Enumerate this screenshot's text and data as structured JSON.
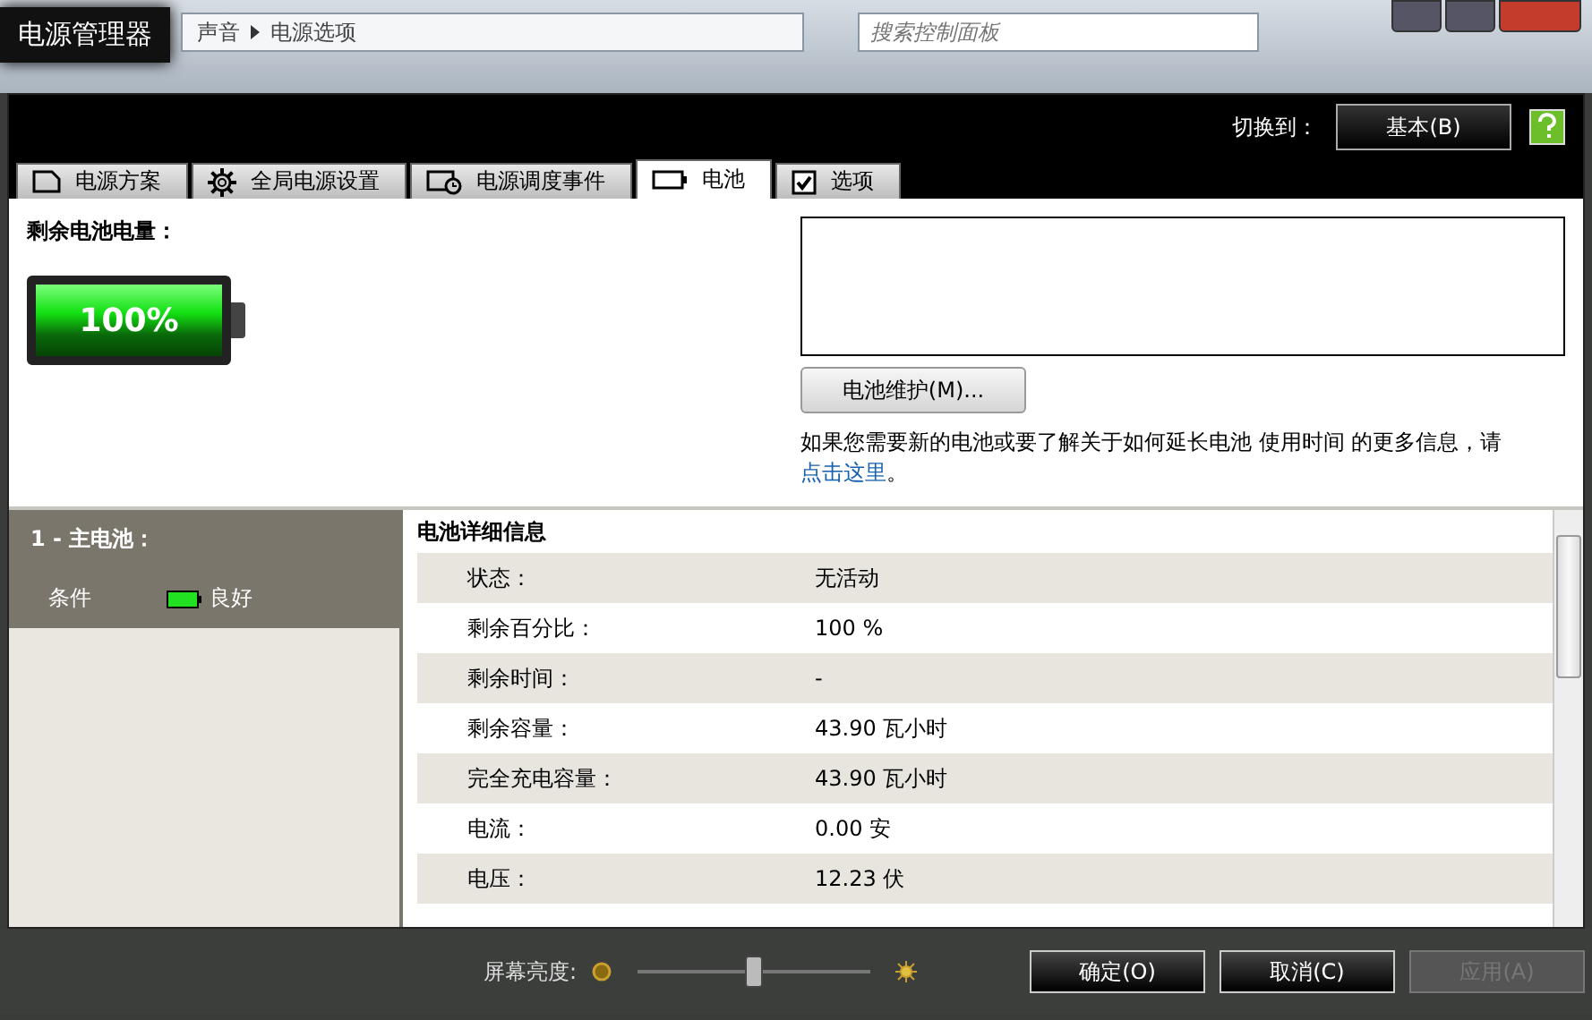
{
  "backdrop": {
    "breadcrumb": [
      "声音",
      "电源选项"
    ],
    "search": {
      "placeholder": "搜索控制面板"
    }
  },
  "window": {
    "title": "电源管理器"
  },
  "header": {
    "switch_label": "切换到：",
    "switch_button": "基本(B)"
  },
  "tabs": [
    {
      "label": "电源方案",
      "kind": "plan",
      "selected": false
    },
    {
      "label": "全局电源设置",
      "kind": "gear",
      "selected": false
    },
    {
      "label": "电源调度事件",
      "kind": "schedule",
      "selected": false
    },
    {
      "label": "电池",
      "kind": "battery",
      "selected": true
    },
    {
      "label": "选项",
      "kind": "check",
      "selected": false
    }
  ],
  "battery": {
    "label": "剩余电池电量：",
    "level": 1,
    "reading": "100%",
    "maintenance_button": "电池维护(M)...",
    "info_text": "如果您需要新的电池或要了解关于如何延长电池 使用时间 的更多信息，请",
    "link": "点击这里",
    "info_end": "。"
  },
  "battery_list": {
    "title": "1 - 主电池：",
    "condition_label": "条件",
    "condition_value": "良好"
  },
  "details": {
    "title": "电池详细信息",
    "rows": [
      {
        "label": "状态：",
        "value": "无活动"
      },
      {
        "label": "剩余百分比：",
        "value": "100 %"
      },
      {
        "label": "剩余时间：",
        "value": "-"
      },
      {
        "label": "剩余容量：",
        "value": "43.90 瓦小时"
      },
      {
        "label": "完全充电容量：",
        "value": "43.90 瓦小时"
      },
      {
        "label": "电流：",
        "value": "0.00 安"
      },
      {
        "label": "电压：",
        "value": "12.23 伏"
      }
    ]
  },
  "footer": {
    "brightness_label": "屏幕亮度:",
    "brightness": {
      "level": 0.5
    },
    "buttons": [
      {
        "label": "确定(O)",
        "disabled": false
      },
      {
        "label": "取消(C)",
        "disabled": false
      },
      {
        "label": "应用(A)",
        "disabled": true
      }
    ]
  }
}
